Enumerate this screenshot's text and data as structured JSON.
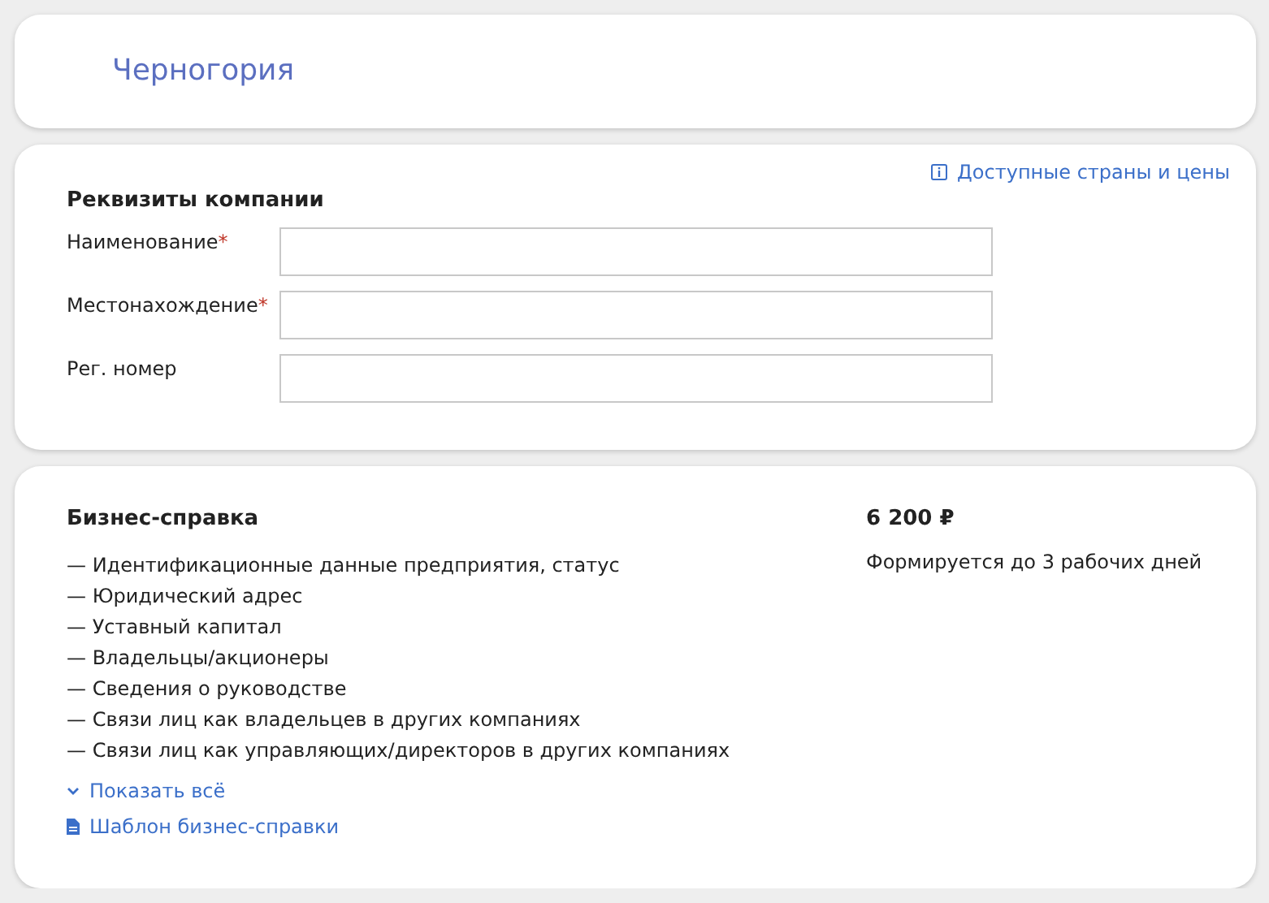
{
  "country": {
    "title": "Черногория"
  },
  "company": {
    "title": "Реквизиты компании",
    "info_link": "Доступные страны и цены",
    "fields": [
      {
        "label": "Наименование",
        "mark": "*"
      },
      {
        "label": "Местонахождение",
        "mark": "*"
      },
      {
        "label": "Рег. номер"
      }
    ]
  },
  "report": {
    "title": "Бизнес-справка",
    "price": "6 200 ₽",
    "term": "Формируется до 3 рабочих дней",
    "items": [
      "— Идентификационные данные предприятия, статус",
      "— Юридический адрес",
      "— Уставный капитал",
      "— Владельцы/акционеры",
      "— Сведения о руководстве",
      "— Связи лиц как владельцев в других компаниях",
      "— Связи лиц как управляющих/директоров в других компаниях"
    ],
    "show_all": {
      "label": "Показать всё",
      "expanded": false
    },
    "template_link": "Шаблон бизнес-справки"
  }
}
